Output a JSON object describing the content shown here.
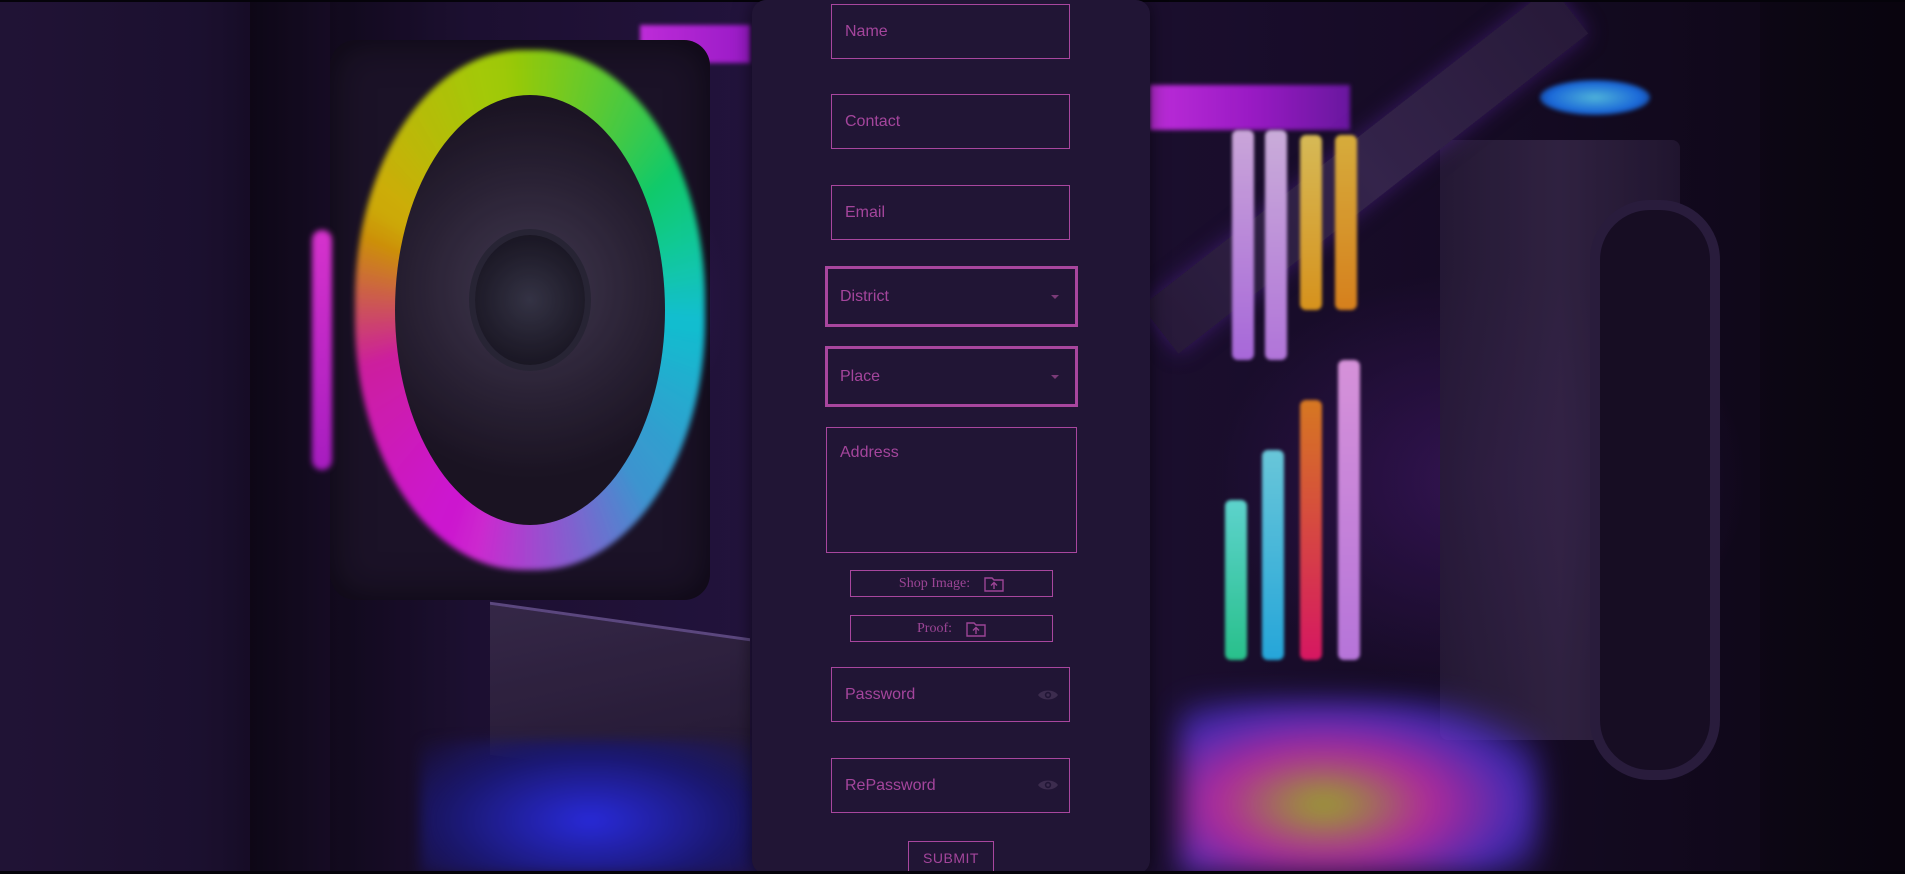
{
  "form": {
    "name_placeholder": "Name",
    "contact_placeholder": "Contact",
    "email_placeholder": "Email",
    "district_label": "District",
    "place_label": "Place",
    "address_placeholder": "Address",
    "shop_image_label": "Shop Image:",
    "proof_label": "Proof:",
    "password_placeholder": "Password",
    "repassword_placeholder": "RePassword",
    "submit_label": "SUBMIT"
  },
  "icons": {
    "upload": "folder-upload-icon",
    "eye": "eye-icon",
    "dropdown": "caret-down-icon"
  },
  "colors": {
    "panel": "#211535",
    "accent": "#a8469e",
    "text": "#a4459c"
  }
}
